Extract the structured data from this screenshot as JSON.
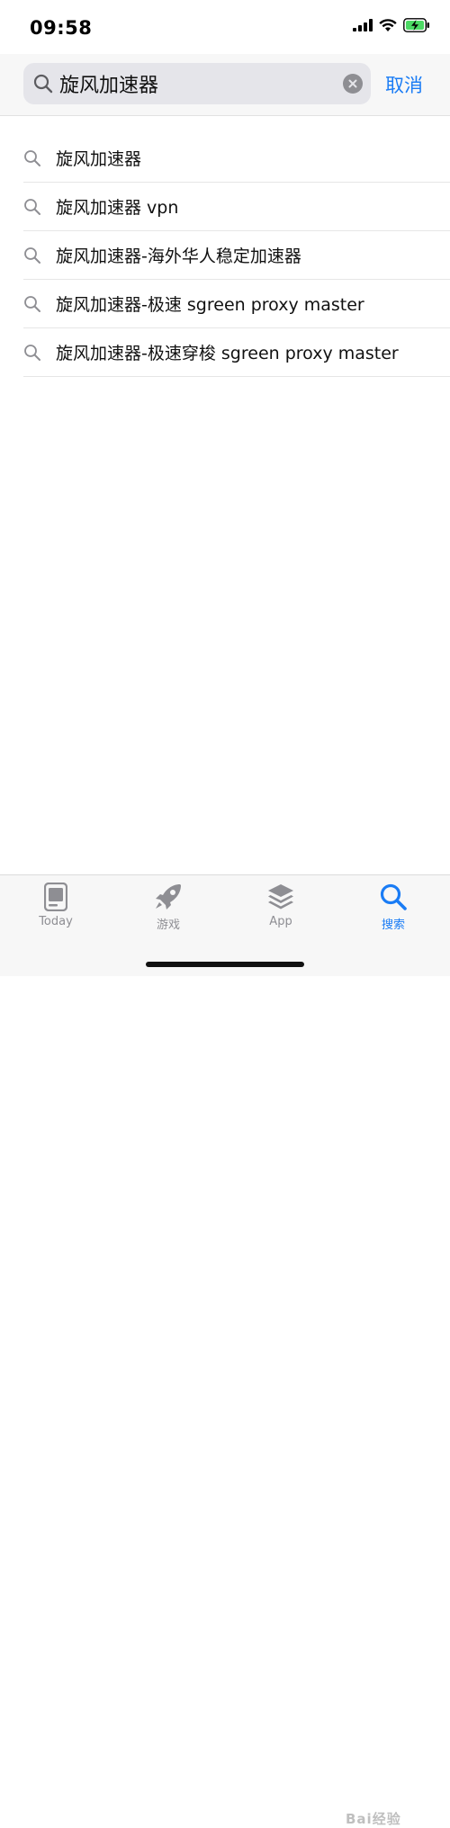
{
  "status_bar": {
    "time": "09:58"
  },
  "search": {
    "query": "旋风加速器",
    "cancel_label": "取消"
  },
  "suggestions": [
    {
      "text": "旋风加速器"
    },
    {
      "text": "旋风加速器 vpn"
    },
    {
      "text": "旋风加速器-海外华人稳定加速器"
    },
    {
      "text": "旋风加速器-极速 sgreen proxy master"
    },
    {
      "text": "旋风加速器-极速穿梭 sgreen proxy master"
    }
  ],
  "tabs": [
    {
      "label": "Today",
      "icon": "today-icon"
    },
    {
      "label": "游戏",
      "icon": "rocket-icon"
    },
    {
      "label": "App",
      "icon": "app-stack-icon"
    },
    {
      "label": "搜索",
      "icon": "search-icon",
      "active": true
    }
  ],
  "watermark": "Bai经验",
  "colors": {
    "accent": "#1a7cf5",
    "inactive": "#8e8e93",
    "battery_fill": "#4cd964"
  }
}
